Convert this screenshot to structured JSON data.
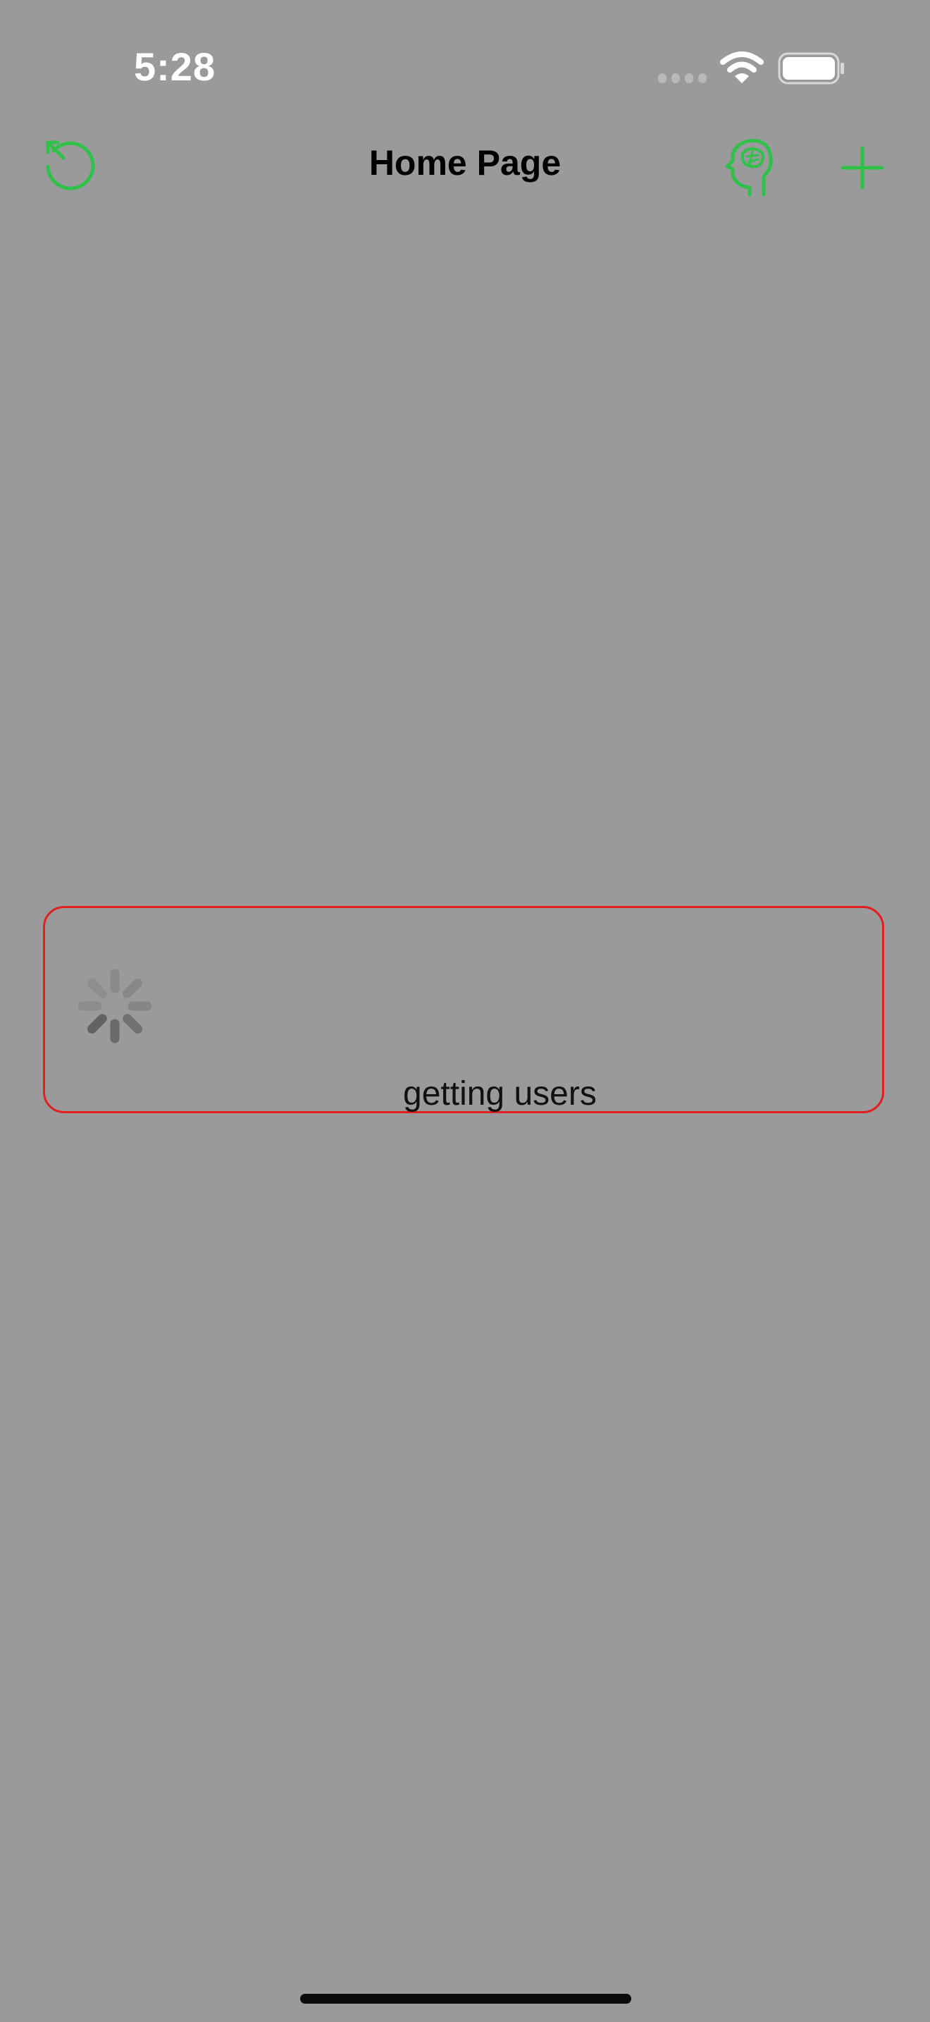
{
  "status_bar": {
    "time": "5:28"
  },
  "nav": {
    "title": "Home Page",
    "left_icon": "refresh-icon",
    "right_icons": [
      "brain-head-icon",
      "plus-icon"
    ],
    "accent_color": "#2fc14a"
  },
  "loading": {
    "message": "getting users",
    "border_color": "#e02020",
    "icon": "activity-spinner-icon"
  },
  "colors": {
    "background": "#9a9a9a",
    "accent": "#2fc14a"
  }
}
